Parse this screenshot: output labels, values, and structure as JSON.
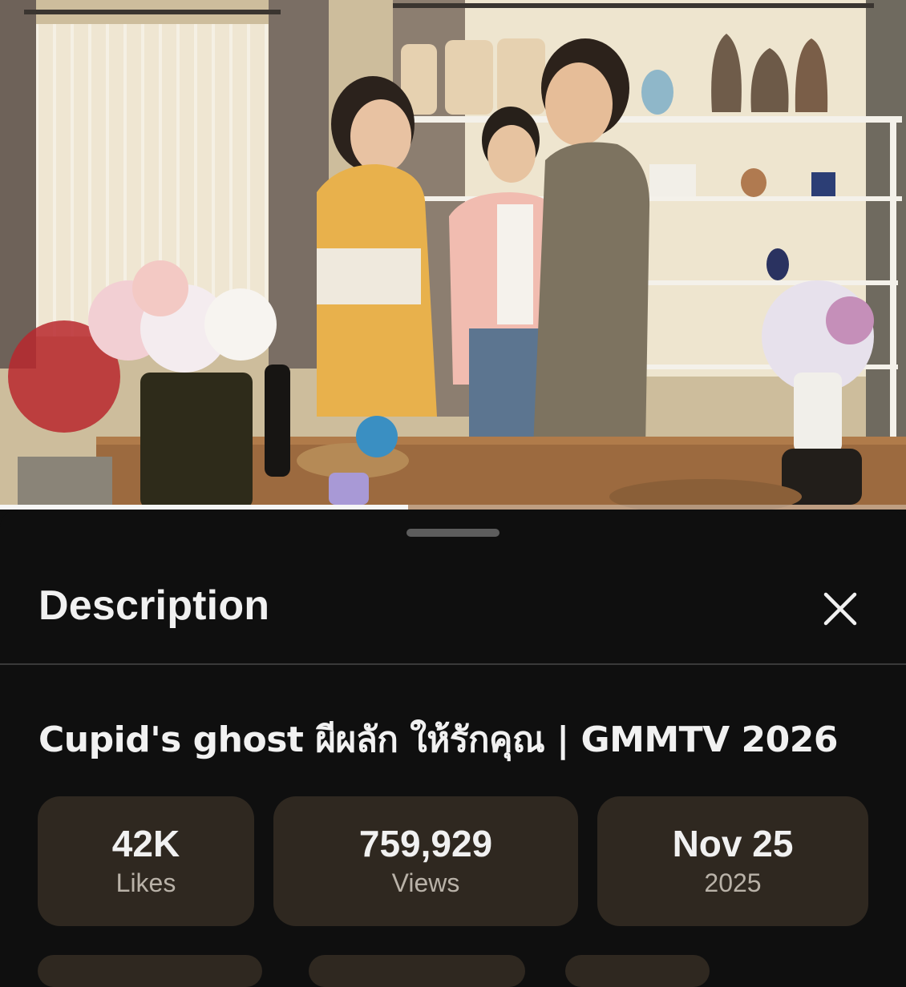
{
  "player": {
    "progress_fraction": 0.45,
    "thumbnail": "indoor-flower-shop-scene"
  },
  "sheet": {
    "title": "Description",
    "close_icon": "close-icon"
  },
  "video": {
    "title": "Cupid's ghost ผีผลัก ให้รักคุณ | GMMTV 2026"
  },
  "stats": [
    {
      "value": "42K",
      "label": "Likes"
    },
    {
      "value": "759,929",
      "label": "Views"
    },
    {
      "value": "Nov 25",
      "label": "2025"
    }
  ],
  "colors": {
    "sheet_bg": "#0f0f0f",
    "stat_bg": "#2f2820",
    "text": "#f1f1f1",
    "secondary_text": "#b9b2a8"
  }
}
